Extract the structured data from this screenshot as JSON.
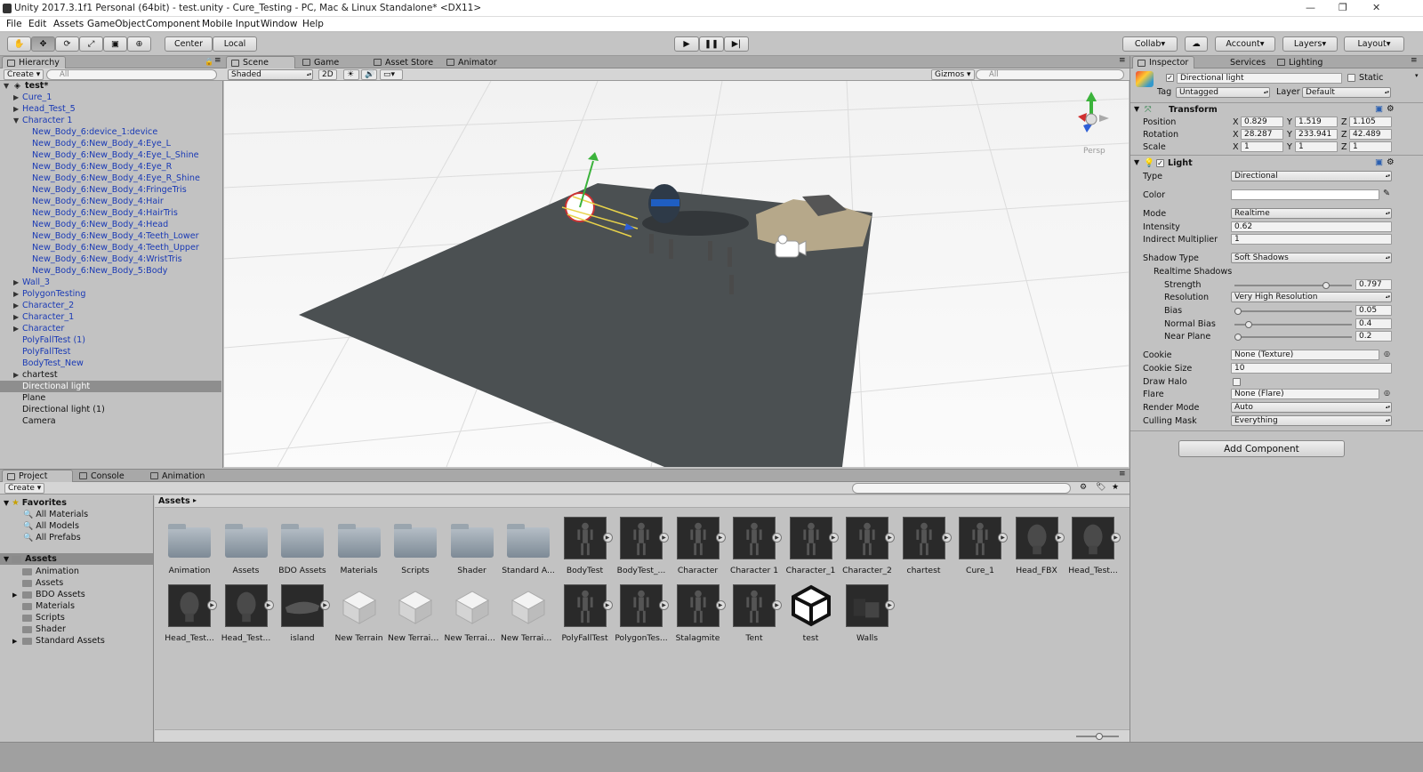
{
  "window": {
    "title": "Unity 2017.3.1f1 Personal (64bit) - test.unity - Cure_Testing - PC, Mac & Linux Standalone* <DX11>"
  },
  "menu": [
    "File",
    "Edit",
    "Assets",
    "GameObject",
    "Component",
    "Mobile Input",
    "Window",
    "Help"
  ],
  "toolbar": {
    "center": "Center",
    "local": "Local",
    "collab": "Collab",
    "account": "Account",
    "layers": "Layers",
    "layout": "Layout"
  },
  "hierarchy": {
    "tab": "Hierarchy",
    "create": "Create",
    "search_placeholder": "All",
    "scene": "test*",
    "items": [
      "Cure_1",
      "Head_Test_5",
      "Character 1",
      "New_Body_6:device_1:device",
      "New_Body_6:New_Body_4:Eye_L",
      "New_Body_6:New_Body_4:Eye_L_Shine",
      "New_Body_6:New_Body_4:Eye_R",
      "New_Body_6:New_Body_4:Eye_R_Shine",
      "New_Body_6:New_Body_4:FringeTris",
      "New_Body_6:New_Body_4:Hair",
      "New_Body_6:New_Body_4:HairTris",
      "New_Body_6:New_Body_4:Head",
      "New_Body_6:New_Body_4:Teeth_Lower",
      "New_Body_6:New_Body_4:Teeth_Upper",
      "New_Body_6:New_Body_4:WristTris",
      "New_Body_6:New_Body_5:Body",
      "Wall_3",
      "PolygonTesting",
      "Character_2",
      "Character_1",
      "Character",
      "PolyFallTest (1)",
      "PolyFallTest",
      "BodyTest_New",
      "chartest",
      "Directional light",
      "Plane",
      "Directional light (1)",
      "Camera"
    ]
  },
  "scene_view": {
    "tabs": [
      "Scene",
      "Game",
      "Asset Store",
      "Animator"
    ],
    "shading": "Shaded",
    "mode2d": "2D",
    "gizmos": "Gizmos",
    "search_placeholder": "All",
    "persp": "Persp"
  },
  "inspector": {
    "tabs": [
      "Inspector",
      "Services",
      "Lighting"
    ],
    "object_name": "Directional light",
    "static": "Static",
    "tag_label": "Tag",
    "tag": "Untagged",
    "layer_label": "Layer",
    "layer": "Default",
    "transform": {
      "title": "Transform",
      "position": {
        "label": "Position",
        "x": "0.829",
        "y": "1.519",
        "z": "1.105"
      },
      "rotation": {
        "label": "Rotation",
        "x": "28.287",
        "y": "233.941",
        "z": "42.489"
      },
      "scale": {
        "label": "Scale",
        "x": "1",
        "y": "1",
        "z": "1"
      }
    },
    "light": {
      "title": "Light",
      "type_label": "Type",
      "type": "Directional",
      "color_label": "Color",
      "mode_label": "Mode",
      "mode": "Realtime",
      "intensity_label": "Intensity",
      "intensity": "0.62",
      "indirect_label": "Indirect Multiplier",
      "indirect": "1",
      "shadow_type_label": "Shadow Type",
      "shadow_type": "Soft Shadows",
      "realtime_shadows": "Realtime Shadows",
      "strength_label": "Strength",
      "strength": "0.797",
      "resolution_label": "Resolution",
      "resolution": "Very High Resolution",
      "bias_label": "Bias",
      "bias": "0.05",
      "normal_bias_label": "Normal Bias",
      "normal_bias": "0.4",
      "near_plane_label": "Near Plane",
      "near_plane": "0.2",
      "cookie_label": "Cookie",
      "cookie": "None (Texture)",
      "cookie_size_label": "Cookie Size",
      "cookie_size": "10",
      "draw_halo_label": "Draw Halo",
      "flare_label": "Flare",
      "flare": "None (Flare)",
      "render_mode_label": "Render Mode",
      "render_mode": "Auto",
      "culling_label": "Culling Mask",
      "culling": "Everything",
      "slider_fractions": {
        "strength": 0.797,
        "bias": 0.0,
        "normal_bias": 0.1,
        "near_plane": 0.0
      }
    },
    "add_component": "Add Component"
  },
  "project": {
    "tabs": [
      "Project",
      "Console",
      "Animation"
    ],
    "create": "Create",
    "favorites": "Favorites",
    "fav_items": [
      "All Materials",
      "All Models",
      "All Prefabs"
    ],
    "assets_root": "Assets",
    "folders": [
      "Animation",
      "Assets",
      "BDO Assets",
      "Materials",
      "Scripts",
      "Shader",
      "Standard Assets"
    ],
    "breadcrumb": "Assets",
    "grid_row1": [
      "Animation",
      "Assets",
      "BDO Assets",
      "Materials",
      "Scripts",
      "Shader",
      "Standard A...",
      "BodyTest",
      "BodyTest_...",
      "Character",
      "Character 1",
      "Character_1",
      "Character_2",
      "chartest",
      "Cure_1",
      "Head_FBX",
      "Head_Test..."
    ],
    "grid_row2": [
      "Head_Test...",
      "Head_Test...",
      "island",
      "New Terrain",
      "New Terrain...",
      "New Terrain...",
      "New Terrain...",
      "PolyFallTest",
      "PolygonTes...",
      "Stalagmite",
      "Tent",
      "test",
      "Walls"
    ]
  }
}
